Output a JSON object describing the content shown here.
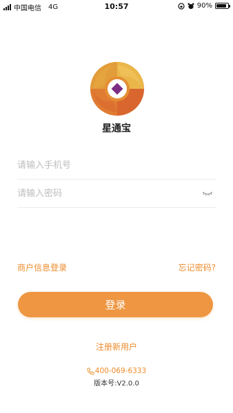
{
  "status_bar": {
    "carrier": "中国电信",
    "network": "4G",
    "time": "10:57",
    "battery_percent": "90%",
    "battery_level": 0.9
  },
  "logo": {
    "colors": {
      "yellow": "#e7b03f",
      "orange": "#e58e34",
      "red": "#d9662f",
      "gem": "#7b2d83"
    }
  },
  "app_name": "星通宝",
  "form": {
    "phone_placeholder": "请输入手机号",
    "phone_value": "",
    "password_placeholder": "请输入密码",
    "password_value": "",
    "password_toggle_icon": "eye-closed-icon"
  },
  "links": {
    "merchant_login": "商户信息登录",
    "forgot_password": "忘记密码?"
  },
  "login_button": "登录",
  "register_link": "注册新用户",
  "footer": {
    "phone": "400-069-6333",
    "phone_icon": "phone-icon",
    "version": "版本号:V2.0.0"
  },
  "colors": {
    "accent": "#ec8b2a",
    "button": "#ee9641"
  }
}
